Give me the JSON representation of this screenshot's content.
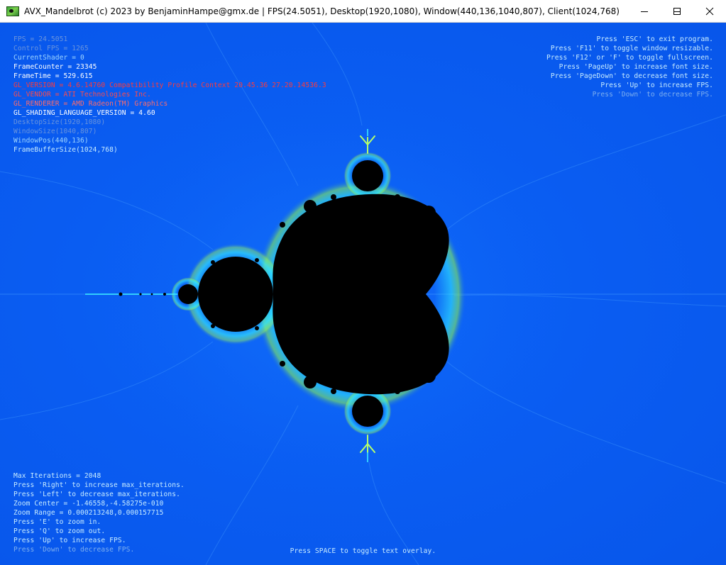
{
  "titlebar": {
    "title": "AVX_Mandelbrot (c) 2023 by BenjaminHampe@gmx.de | FPS(24.5051), Desktop(1920,1080), Window(440,136,1040,807), Client(1024,768)",
    "icon": "app-fractal-icon",
    "buttons": [
      "minimize",
      "maximize",
      "close"
    ]
  },
  "colors": {
    "background": "#0a5cf2",
    "set": "#000000",
    "dim_text": "#6f9be6",
    "bright_text": "#a8dcff",
    "white_text": "#ffffff",
    "red_text": "#ff4a4a",
    "orange_text": "#ff6a2a"
  },
  "top_left_info": [
    {
      "text": "FPS = 24.5051",
      "color": "#6a94dc"
    },
    {
      "text": "Control FPS = 1265",
      "color": "#6a94dc"
    },
    {
      "text": "CurrentShader = 0",
      "color": "#9fd6ff"
    },
    {
      "text": "FrameCounter = 23345",
      "color": "#ffffff"
    },
    {
      "text": "FrameTime = 529.615",
      "color": "#ffffff"
    },
    {
      "text": "GL_VERSION = 4.6.14760 Compatibility Profile Context 20.45.36 27.20.14536.3",
      "color": "#ff3a3a"
    },
    {
      "text": "GL_VENDOR = ATI Technologies Inc.",
      "color": "#ff4a4a"
    },
    {
      "text": "GL_RENDERER = AMD Radeon(TM) Graphics",
      "color": "#ff6a6a"
    },
    {
      "text": "GL_SHADING_LANGUAGE_VERSION = 4.60",
      "color": "#ffffff"
    },
    {
      "text": "DesktopSize(1920,1080)",
      "color": "#6a94dc"
    },
    {
      "text": "WindowSize(1040,807)",
      "color": "#6a94dc"
    },
    {
      "text": "WindowPos(440,136)",
      "color": "#9fd6ff"
    },
    {
      "text": "FrameBufferSize(1024,768)",
      "color": "#c8ecff"
    }
  ],
  "top_right_help": [
    {
      "text": "Press 'ESC' to exit program.",
      "color": "#c8ecff"
    },
    {
      "text": "Press 'F11' to toggle window resizable.",
      "color": "#c8ecff"
    },
    {
      "text": "Press 'F12' or 'F' to toggle fullscreen.",
      "color": "#c8ecff"
    },
    {
      "text": "Press 'PageUp' to increase font size.",
      "color": "#c8ecff"
    },
    {
      "text": "Press 'PageDown' to decrease font size.",
      "color": "#c8ecff"
    },
    {
      "text": "Press 'Up' to increase FPS.",
      "color": "#c8ecff"
    },
    {
      "text": "Press 'Down' to decrease FPS.",
      "color": "#7fb0ee"
    }
  ],
  "bottom_left_info": [
    {
      "text": "Max Iterations = 2048",
      "color": "#c8ecff"
    },
    {
      "text": "Press 'Right' to increase max_iterations.",
      "color": "#c8ecff"
    },
    {
      "text": "Press 'Left' to decrease max_iterations.",
      "color": "#c8ecff"
    },
    {
      "text": "Zoom Center = -1.46558,-4.58275e-010",
      "color": "#c8ecff"
    },
    {
      "text": "Zoom Range = 0.000213248,0.000157715",
      "color": "#c8ecff"
    },
    {
      "text": "Press 'E' to zoom in.",
      "color": "#c8ecff"
    },
    {
      "text": "Press 'Q' to zoom out.",
      "color": "#c8ecff"
    },
    {
      "text": "Press 'Up' to increase FPS.",
      "color": "#c8ecff"
    },
    {
      "text": "Press 'Down' to decrease FPS.",
      "color": "#7fb0ee"
    }
  ],
  "bottom_center_hint": "Press SPACE to toggle text overlay."
}
